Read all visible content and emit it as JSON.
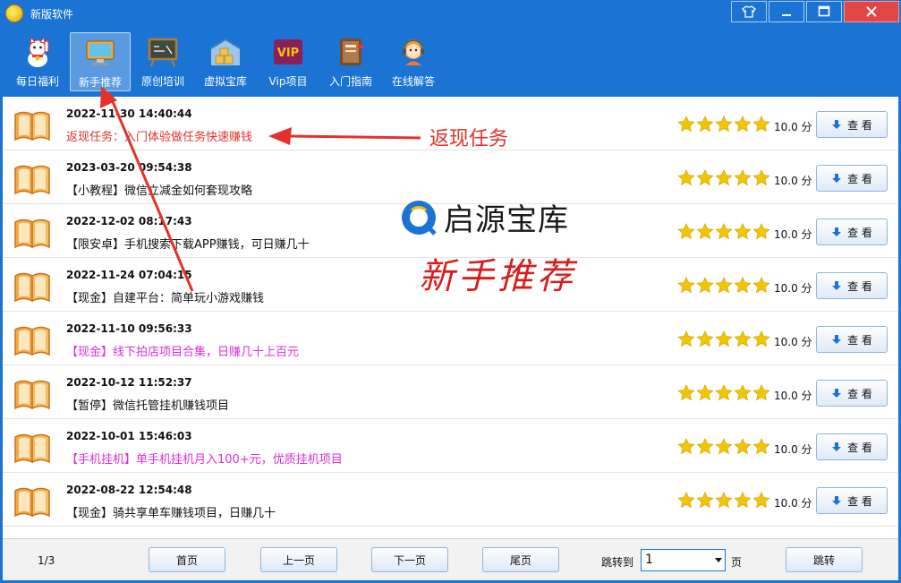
{
  "window": {
    "title": "新版软件"
  },
  "toolbar": {
    "items": [
      {
        "label": "每日福利",
        "icon": "lucky-cat-icon"
      },
      {
        "label": "新手推荐",
        "icon": "monitor-icon"
      },
      {
        "label": "原创培训",
        "icon": "blackboard-icon"
      },
      {
        "label": "虚拟宝库",
        "icon": "warehouse-icon"
      },
      {
        "label": "Vip项目",
        "icon": "vip-icon"
      },
      {
        "label": "入门指南",
        "icon": "guide-book-icon"
      },
      {
        "label": "在线解答",
        "icon": "support-agent-icon"
      }
    ],
    "active_index": 1
  },
  "list": {
    "rows": [
      {
        "date": "2022-11-30 14:40:44",
        "title": "返现任务：入门体验做任务快速赚钱",
        "color": "#e3322a",
        "rating": 5,
        "score": "10.0 分",
        "button": "查 看"
      },
      {
        "date": "2023-03-20 09:54:38",
        "title": "【小教程】微信立减金如何套现攻略",
        "color": "#111111",
        "rating": 5,
        "score": "10.0 分",
        "button": "查 看"
      },
      {
        "date": "2022-12-02 08:17:43",
        "title": "【限安卓】手机搜索下载APP赚钱，可日赚几十",
        "color": "#111111",
        "rating": 5,
        "score": "10.0 分",
        "button": "查 看"
      },
      {
        "date": "2022-11-24 07:04:15",
        "title": "【现金】自建平台：简单玩小游戏赚钱",
        "color": "#111111",
        "rating": 5,
        "score": "10.0 分",
        "button": "查 看"
      },
      {
        "date": "2022-11-10 09:56:33",
        "title": "【现金】线下拍店项目合集，日赚几十上百元",
        "color": "#d92fd9",
        "rating": 5,
        "score": "10.0 分",
        "button": "查 看"
      },
      {
        "date": "2022-10-12 11:52:37",
        "title": "【暂停】微信托管挂机赚钱项目",
        "color": "#111111",
        "rating": 5,
        "score": "10.0 分",
        "button": "查 看"
      },
      {
        "date": "2022-10-01 15:46:03",
        "title": "【手机挂机】单手机挂机月入100+元，优质挂机项目",
        "color": "#d92fd9",
        "rating": 5,
        "score": "10.0 分",
        "button": "查 看"
      },
      {
        "date": "2022-08-22 12:54:48",
        "title": "【现金】骑共享单车赚钱项目，日赚几十",
        "color": "#111111",
        "rating": 5,
        "score": "10.0 分",
        "button": "查 看"
      }
    ]
  },
  "overlay": {
    "watermark_brand": "启源宝库",
    "watermark_subtitle": "新手推荐",
    "annotation_label": "返现任务"
  },
  "pager": {
    "page_info": "1/3",
    "first": "首页",
    "prev": "上一页",
    "next": "下一页",
    "last": "尾页",
    "jump_label": "跳转到",
    "current_page": "1",
    "unit": "页",
    "jump_button": "跳转"
  },
  "colors": {
    "chrome": "#1b73d3",
    "accent_red": "#e3322a",
    "accent_magenta": "#d92fd9",
    "star": "#f5c400"
  }
}
